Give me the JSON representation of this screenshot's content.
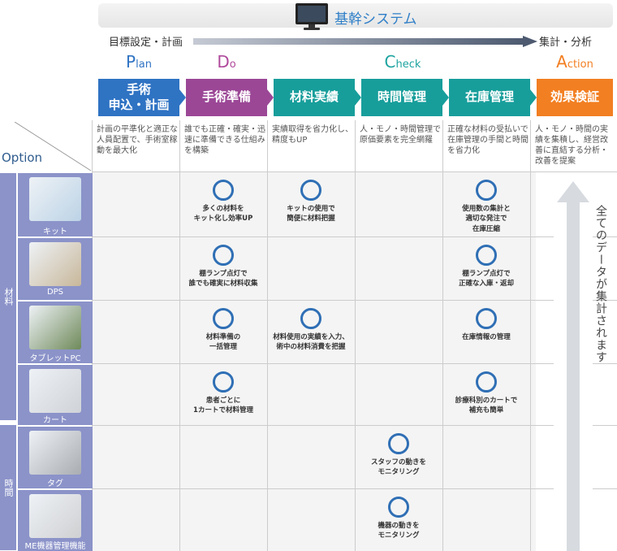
{
  "header": {
    "system": "基幹システム",
    "flow_left": "目標設定・計画",
    "flow_right": "集計・分析"
  },
  "phases": [
    {
      "initial": "P",
      "rest": "lan",
      "color": "#2f73c3"
    },
    {
      "initial": "D",
      "rest": "o",
      "color": "#b04a9c"
    },
    {
      "initial": "C",
      "rest": "heck",
      "color": "#1da3a0"
    },
    {
      "initial": "A",
      "rest": "ction",
      "color": "#f27f22"
    }
  ],
  "steps": [
    {
      "label": "手術\n申込・計画",
      "desc": "計画の平準化と適正な人員配置で、手術室稼動を最大化",
      "color": "#2f73c3"
    },
    {
      "label": "手術準備",
      "desc": "誰でも正確・確実・迅速に準備できる仕組みを構築",
      "color": "#9b4796"
    },
    {
      "label": "材料実績",
      "desc": "実績取得を省力化し、精度もUP",
      "color": "#179e9b"
    },
    {
      "label": "時間管理",
      "desc": "人・モノ・時間管理で原価要素を完全網羅",
      "color": "#179e9b"
    },
    {
      "label": "在庫管理",
      "desc": "正確な材料の受払いで在庫管理の手間と時間を省力化",
      "color": "#179e9b"
    },
    {
      "label": "効果検証",
      "desc": "人・モノ・時間の実績を集積し、経営改善に直結する分析・改善を提案",
      "color": "#f27f22"
    }
  ],
  "option_label": "Option",
  "groups": [
    {
      "label": "材料"
    },
    {
      "label": "時間"
    }
  ],
  "rows": [
    {
      "label": "キット",
      "icon": "kit-photo"
    },
    {
      "label": "DPS",
      "icon": "dps-shelf-photo"
    },
    {
      "label": "タブレットPC",
      "icon": "tablet-photo"
    },
    {
      "label": "カート",
      "icon": "cart-photo"
    },
    {
      "label": "タグ",
      "icon": "tag-photo"
    },
    {
      "label": "ME機器管理機能",
      "icon": "me-device-photo"
    }
  ],
  "cells": [
    {
      "row": 0,
      "col": 1,
      "text": "多くの材料を\nキット化し効率UP"
    },
    {
      "row": 0,
      "col": 2,
      "text": "キットの使用で\n簡便に材料把握"
    },
    {
      "row": 0,
      "col": 4,
      "text": "使用数の集計と\n適切な発注で\n在庫圧縮"
    },
    {
      "row": 1,
      "col": 1,
      "text": "棚ランプ点灯で\n誰でも確実に材料収集"
    },
    {
      "row": 1,
      "col": 4,
      "text": "棚ランプ点灯で\n正確な入庫・返却"
    },
    {
      "row": 2,
      "col": 1,
      "text": "材料準備の\n一括管理"
    },
    {
      "row": 2,
      "col": 2,
      "text": "材料使用の実績を入力、\n術中の材料消費を把握"
    },
    {
      "row": 2,
      "col": 4,
      "text": "在庫情報の管理"
    },
    {
      "row": 3,
      "col": 1,
      "text": "患者ごとに\n1カートで材料管理"
    },
    {
      "row": 3,
      "col": 4,
      "text": "診療科別のカートで\n補充も簡単"
    },
    {
      "row": 4,
      "col": 3,
      "text": "スタッフの動きを\nモニタリング"
    },
    {
      "row": 5,
      "col": 3,
      "text": "機器の動きを\nモニタリング"
    }
  ],
  "arrow_text": "全てのデータが集計されます"
}
